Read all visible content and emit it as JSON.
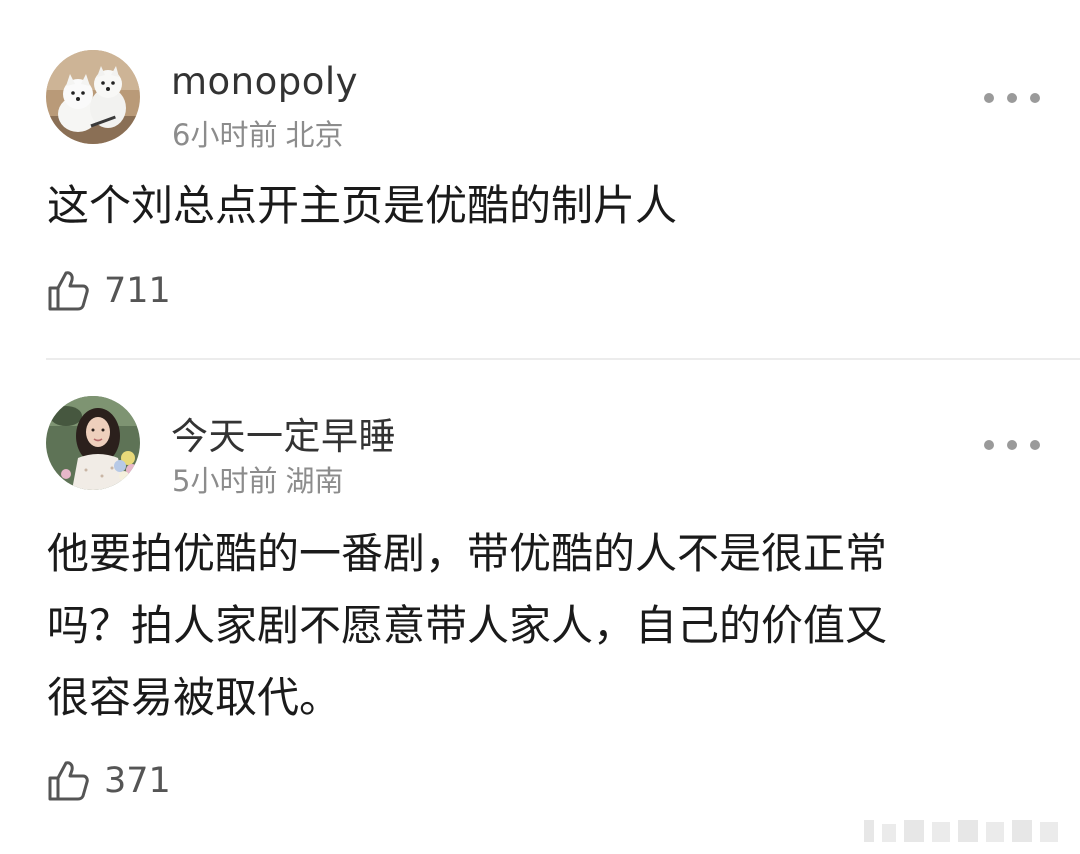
{
  "comments": [
    {
      "username": "monopoly",
      "time": "6小时前",
      "location": "北京",
      "text": "这个刘总点开主页是优酷的制片人",
      "likes": "711",
      "avatar_icon": "avatar-two-white-dogs-icon"
    },
    {
      "username": "今天一定早睡",
      "time": "5小时前",
      "location": "湖南",
      "text": "他要拍优酷的一番剧，带优酷的人不是很正常\n吗？拍人家剧不愿意带人家人，自己的价值又\n很容易被取代。",
      "likes": "371",
      "avatar_icon": "avatar-woman-with-flowers-icon"
    }
  ],
  "icons": {
    "more": "more-horizontal-icon",
    "like": "thumbs-up-icon"
  },
  "colors": {
    "username": "#333333",
    "meta": "#8c8c8c",
    "content": "#1a1a1a",
    "divider": "#ececec"
  }
}
